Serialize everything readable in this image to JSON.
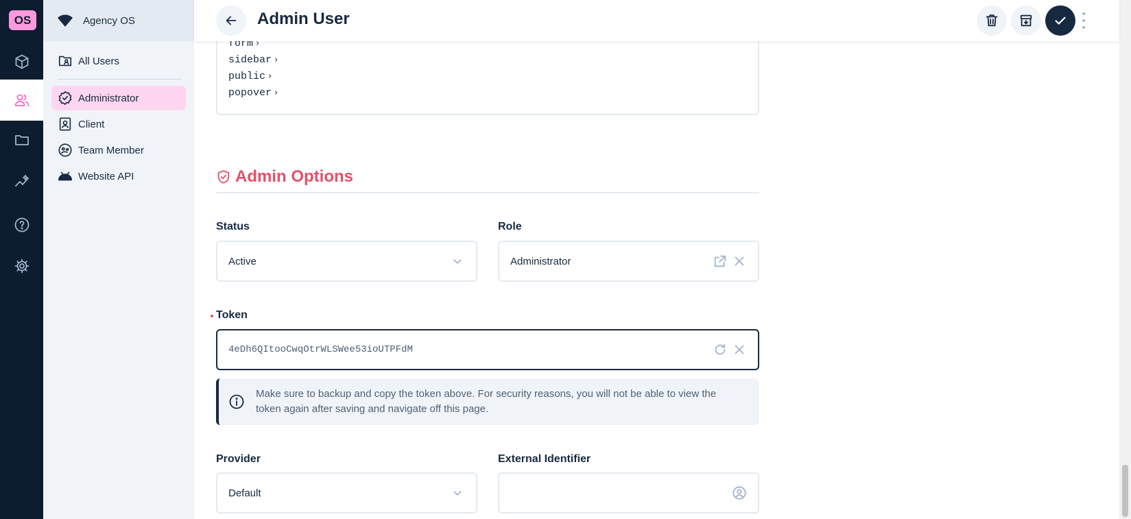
{
  "app": {
    "logo_text": "OS"
  },
  "modules": [
    {
      "icon": "cube-icon",
      "active": false
    },
    {
      "icon": "users-icon",
      "active": true
    },
    {
      "icon": "folder-icon",
      "active": false
    },
    {
      "icon": "insights-icon",
      "active": false
    },
    {
      "icon": "help-icon",
      "active": false
    },
    {
      "icon": "settings-icon",
      "active": false
    }
  ],
  "nav": {
    "project_name": "Agency OS",
    "items": [
      {
        "label": "All Users",
        "icon": "folder-user-icon",
        "active": false
      },
      {
        "label": "Administrator",
        "icon": "verified-badge-icon",
        "active": true
      },
      {
        "label": "Client",
        "icon": "contact-badge-icon",
        "active": false
      },
      {
        "label": "Team Member",
        "icon": "face-icon",
        "active": false
      },
      {
        "label": "Website API",
        "icon": "android-icon",
        "active": false
      }
    ]
  },
  "header": {
    "title": "Admin User",
    "actions": [
      "back-icon",
      "delete-icon",
      "archive-icon",
      "save-check-icon",
      "more-vertical-icon"
    ]
  },
  "code_list": {
    "lines": [
      "form",
      "sidebar",
      "public",
      "popover"
    ],
    "chevron": "›"
  },
  "section": {
    "title": "Admin Options",
    "icon": "admin-shield-icon"
  },
  "fields": {
    "status": {
      "label": "Status",
      "value": "Active"
    },
    "role": {
      "label": "Role",
      "value": "Administrator"
    },
    "token": {
      "label": "Token",
      "value": "4eDh6QItooCwqOtrWLSWee53ioUTPFdM",
      "required": true
    },
    "provider": {
      "label": "Provider",
      "value": "Default"
    },
    "external_identifier": {
      "label": "External Identifier",
      "value": ""
    }
  },
  "notice": {
    "text": "Make sure to backup and copy the token above. For security reasons, you will not be able to view the token again after saving and navigate off this page."
  },
  "colors": {
    "module_bar": "#0e1c2f",
    "accent_pink": "#ff99dd",
    "active_nav": "#ffd6f1",
    "danger_title": "#e35169",
    "primary": "#172940"
  }
}
